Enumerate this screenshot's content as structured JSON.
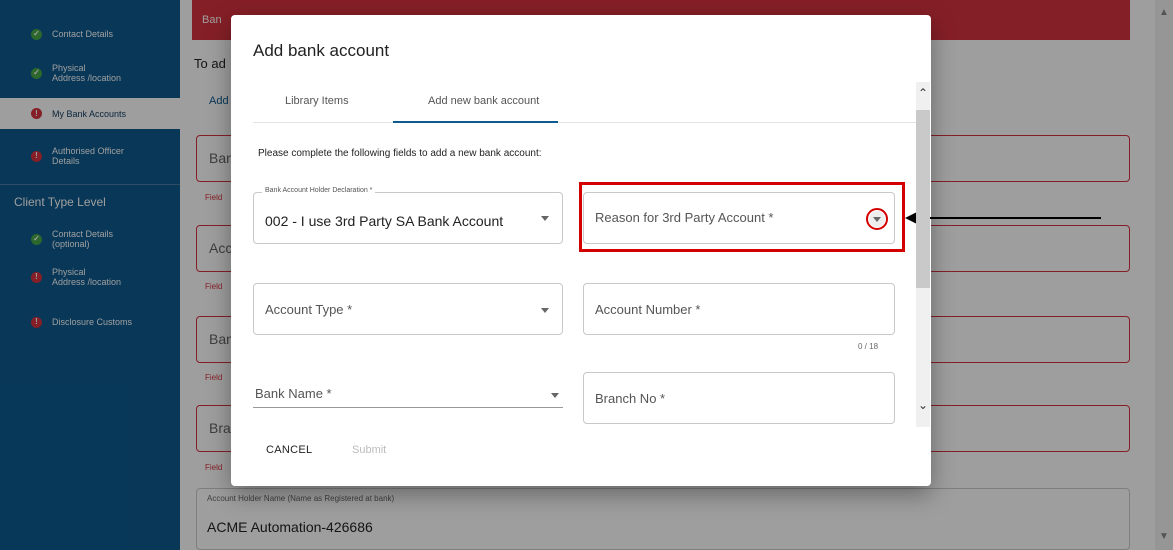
{
  "sidebar": {
    "items": [
      {
        "label": "Contact Details",
        "status": "ok"
      },
      {
        "label": "Physical\nAddress /location",
        "status": "ok"
      },
      {
        "label": "My Bank Accounts",
        "status": "error",
        "active": true
      },
      {
        "label": "Authorised Officer\nDetails",
        "status": "error"
      }
    ],
    "section_heading": "Client Type Level",
    "section_items": [
      {
        "label": "Contact Details\n(optional)",
        "status": "ok"
      },
      {
        "label": "Physical\nAddress /location",
        "status": "error"
      },
      {
        "label": "Disclosure Customs",
        "status": "error"
      }
    ]
  },
  "main": {
    "banner_text": "Ban",
    "intro_text": "To ad",
    "add_link": "Add",
    "fields": [
      {
        "label": "Ban",
        "error": "Field"
      },
      {
        "label": "Acc",
        "error": "Field"
      },
      {
        "label": "Ban",
        "error": "Field"
      },
      {
        "label": "Bra",
        "error": "Field"
      }
    ],
    "holder_caption": "Account Holder Name (Name as Registered at bank)",
    "holder_value": "ACME Automation-426686"
  },
  "dialog": {
    "title": "Add bank account",
    "tabs": [
      {
        "label": "Library Items",
        "active": false
      },
      {
        "label": "Add new bank account",
        "active": true
      }
    ],
    "instructions": "Please complete the following fields to add a new bank account:",
    "declaration_label": "Bank Account Holder Declaration *",
    "declaration_value": "002 - I use 3rd Party SA Bank Account",
    "reason_placeholder": "Reason for 3rd Party Account *",
    "account_type_placeholder": "Account Type *",
    "account_number_placeholder": "Account Number *",
    "account_number_counter": "0 / 18",
    "bank_name_placeholder": "Bank Name *",
    "branch_no_placeholder": "Branch No *",
    "cancel_label": "CANCEL",
    "submit_label": "Submit"
  },
  "colors": {
    "sidebar": "#0d5a8f",
    "error": "#d7333f",
    "ok": "#47a647",
    "annotation": "#d40000"
  }
}
